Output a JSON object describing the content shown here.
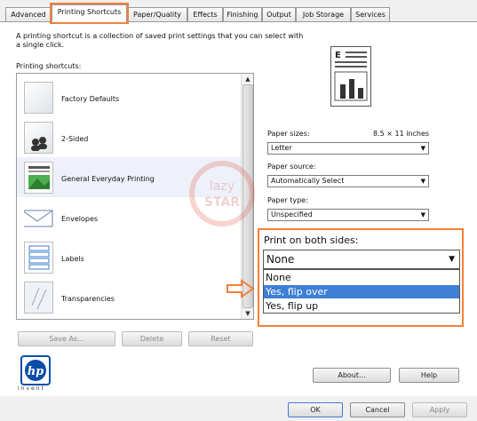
{
  "tabs": [
    "Advanced",
    "Printing Shortcuts",
    "Paper/Quality",
    "Effects",
    "Finishing",
    "Output",
    "Job Storage",
    "Services"
  ],
  "description": "A printing shortcut is a collection of saved print settings that you can select with a single click.",
  "shortcuts_label": "Printing shortcuts:",
  "shortcuts": [
    {
      "label": "Factory Defaults",
      "icon": "page-icon"
    },
    {
      "label": "2-Sided",
      "icon": "two-sided-icon"
    },
    {
      "label": "General Everyday Printing",
      "icon": "document-icon"
    },
    {
      "label": "Envelopes",
      "icon": "envelope-icon"
    },
    {
      "label": "Labels",
      "icon": "labels-icon"
    },
    {
      "label": "Transparencies",
      "icon": "transparency-icon"
    }
  ],
  "list_buttons": {
    "save_as": "Save As...",
    "delete": "Delete",
    "reset": "Reset"
  },
  "paper_sizes": {
    "label": "Paper sizes:",
    "dimension": "8.5 × 11 inches",
    "value": "Letter"
  },
  "paper_source": {
    "label": "Paper source:",
    "value": "Automatically Select"
  },
  "paper_type": {
    "label": "Paper type:",
    "value": "Unspecified"
  },
  "print_both_sides": {
    "label": "Print on both sides:",
    "value": "None",
    "options": [
      "None",
      "Yes, flip over",
      "Yes, flip up"
    ],
    "highlighted": "Yes, flip over"
  },
  "watermark_text": {
    "top": "lazy",
    "bottom": "STAR"
  },
  "logo": {
    "text": "hp",
    "tagline": "invent"
  },
  "bottom_buttons": {
    "about": "About...",
    "help": "Help",
    "ok": "OK",
    "cancel": "Cancel",
    "apply": "Apply"
  },
  "colors": {
    "accent": "#f4803a",
    "selection": "#3d7fd6",
    "hp_blue": "#0a4da8"
  }
}
